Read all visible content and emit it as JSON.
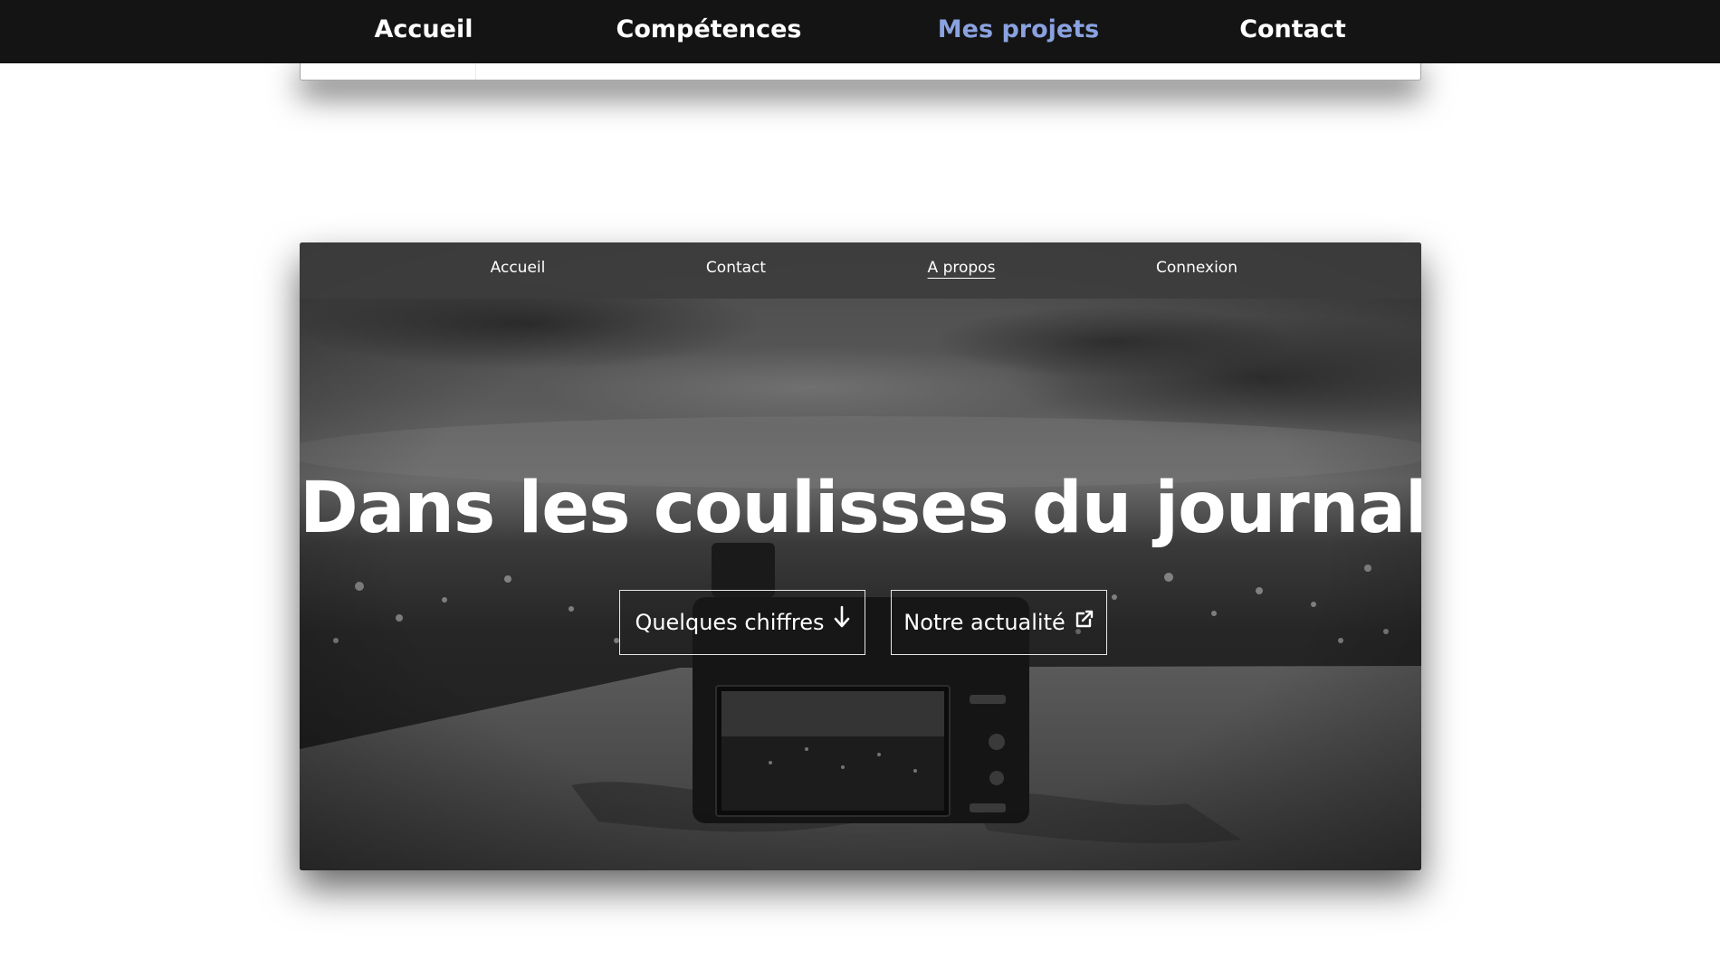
{
  "site_nav": {
    "items": [
      {
        "label": "Accueil"
      },
      {
        "label": "Compétences"
      },
      {
        "label": "Mes projets"
      },
      {
        "label": "Contact"
      }
    ]
  },
  "hero": {
    "nav": {
      "items": [
        {
          "label": "Accueil"
        },
        {
          "label": "Contact"
        },
        {
          "label": "A propos"
        },
        {
          "label": "Connexion"
        }
      ]
    },
    "title": "Dans les coulisses du journal",
    "buttons": {
      "figures": {
        "label": "Quelques chiffres",
        "icon": "arrow-down-icon"
      },
      "news": {
        "label": "Notre actualité",
        "icon": "external-link-icon"
      }
    }
  },
  "colors": {
    "nav_background": "#141414",
    "active_link": "#8aa2e0",
    "hero_text": "#ffffff"
  }
}
